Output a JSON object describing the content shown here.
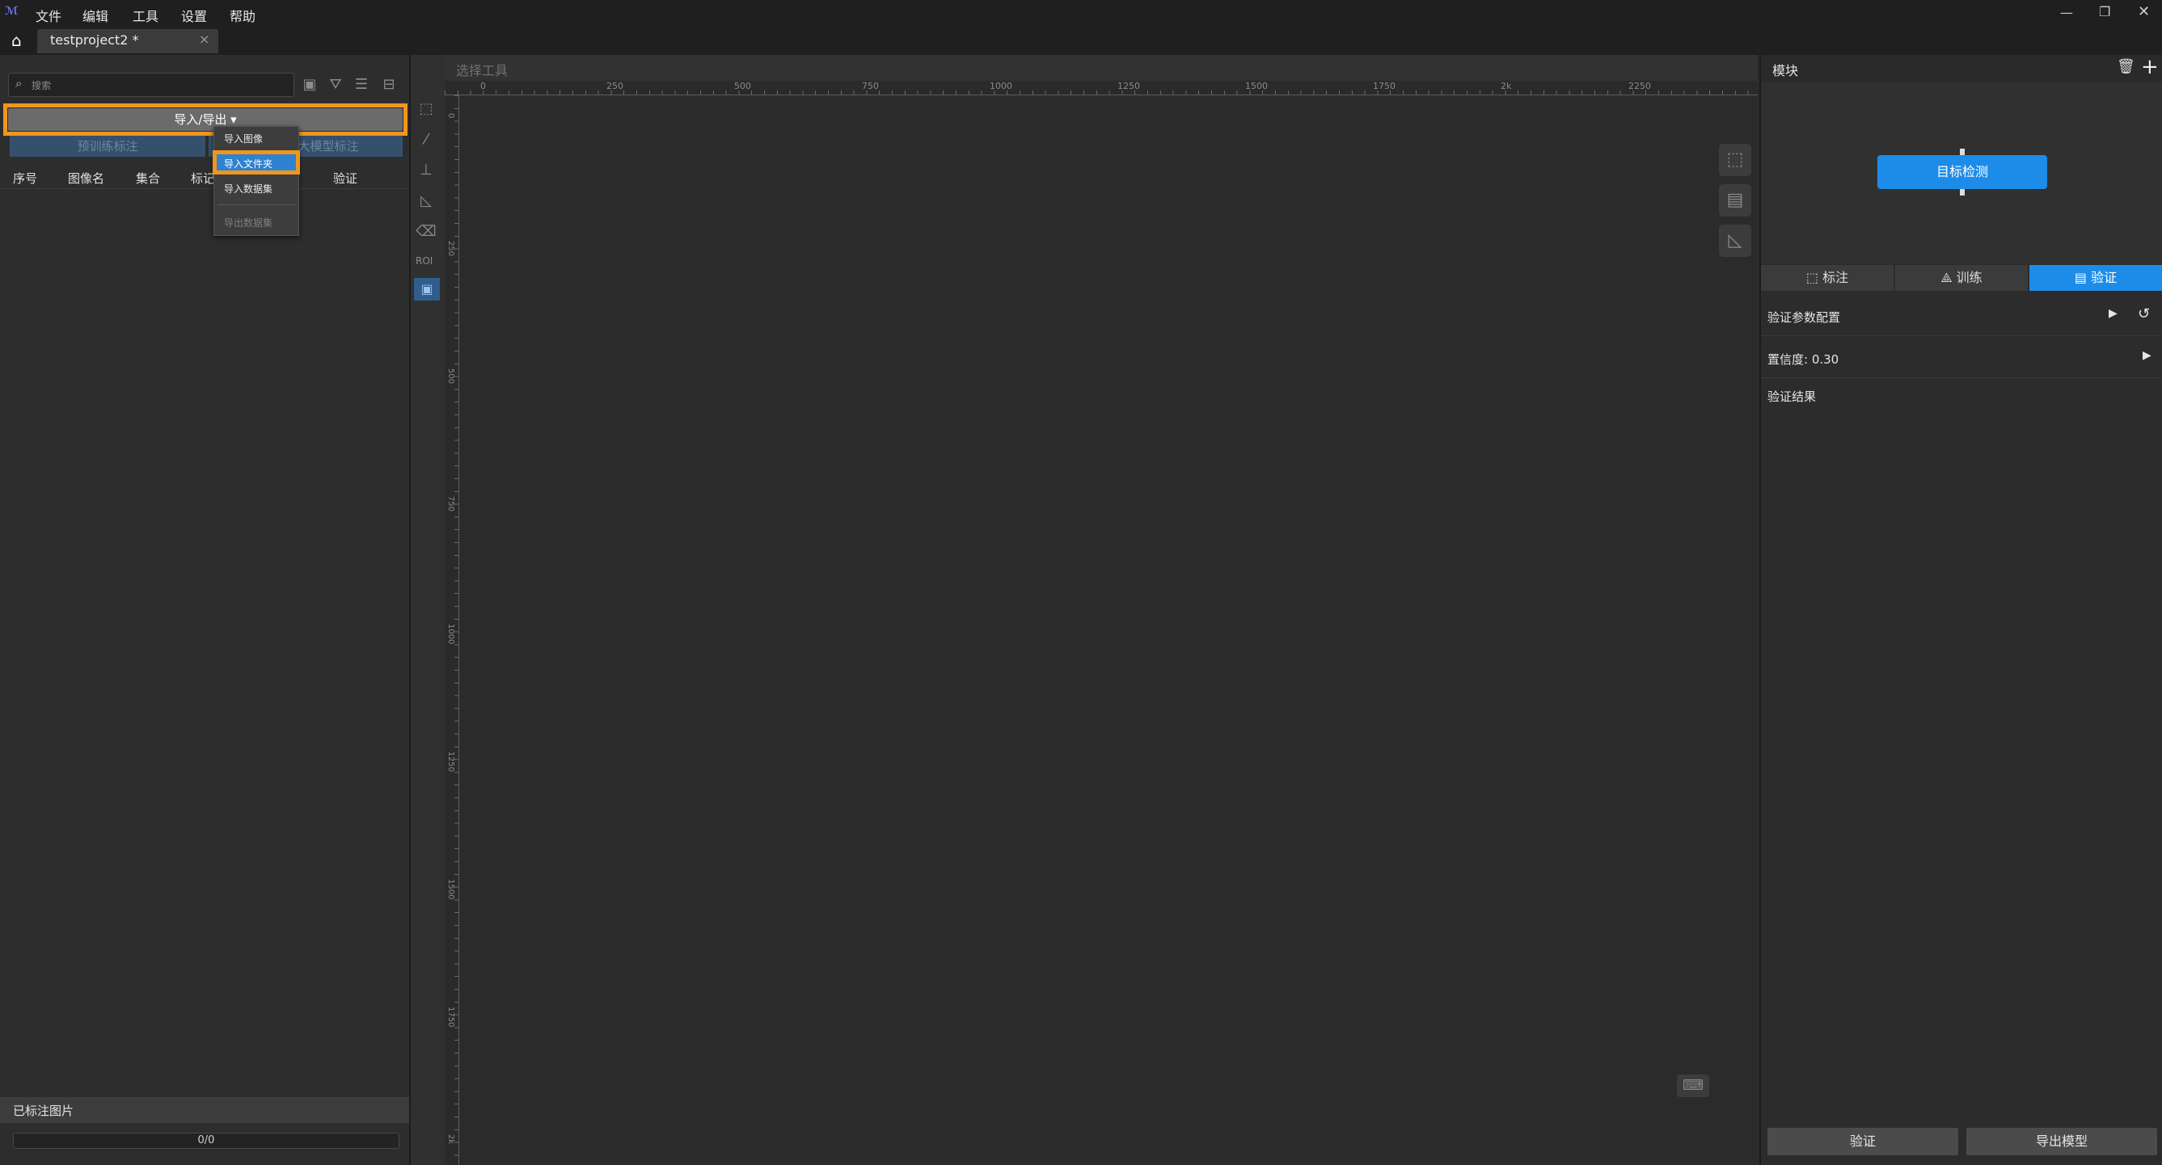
{
  "menu": [
    "文件",
    "编辑",
    "工具",
    "设置",
    "帮助"
  ],
  "tab": {
    "title": "testproject2 *",
    "close": "×"
  },
  "left": {
    "search_placeholder": "搜索",
    "io_button": "导入/导出 ▾",
    "pretrain_label": "预训练标注",
    "llm_label": "大模型标注",
    "columns": [
      "序号",
      "图像名",
      "集合",
      "标记",
      "验证"
    ],
    "dropdown": [
      "导入图像",
      "导入文件夹",
      "导入数据集",
      "导出数据集"
    ],
    "annotated_label": "已标注图片",
    "progress_text": "0/0"
  },
  "canvas": {
    "header": "选择工具",
    "ruler_ticks": [
      "0",
      "250",
      "500",
      "750",
      "1000",
      "1250",
      "1500",
      "1750",
      "2k",
      "2250"
    ],
    "vruler_ticks": [
      "0",
      "250",
      "500",
      "750",
      "1000",
      "1250",
      "1500",
      "1750",
      "2k"
    ]
  },
  "right": {
    "title": "模块",
    "node_label": "目标检测",
    "tabs": [
      "标注",
      "训练",
      "验证"
    ],
    "rows": [
      "验证参数配置",
      "置信度: 0.30",
      "验证结果"
    ],
    "validate_button": "验证",
    "export_button": "导出模型"
  },
  "colors": {
    "accent": "#1d8ce8",
    "highlight": "#f1961e"
  }
}
